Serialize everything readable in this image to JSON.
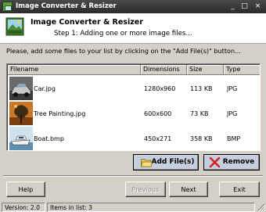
{
  "window": {
    "title": "Image Converter & Resizer",
    "controls": {
      "minimize": "_",
      "maximize": "□",
      "close": "×"
    }
  },
  "header": {
    "title": "Image Converter & Resizer",
    "step": "Step 1: Adding one or more image files..."
  },
  "instruction": "Please, add some files to your list by clicking on the \"Add File(s)\" button...",
  "file_list": {
    "columns": [
      "Filename",
      "Dimensions",
      "Size",
      "Type"
    ],
    "rows": [
      {
        "filename": "Car.jpg",
        "dimensions": "1280x960",
        "size": "113 KB",
        "type": "JPG",
        "thumb": "car"
      },
      {
        "filename": "Tree Painting.jpg",
        "dimensions": "600x600",
        "size": "73 KB",
        "type": "JPG",
        "thumb": "tree-painting"
      },
      {
        "filename": "Boat.bmp",
        "dimensions": "450x271",
        "size": "358 KB",
        "type": "BMP",
        "thumb": "boat"
      }
    ]
  },
  "actions": {
    "add_files": "Add File(s)",
    "remove": "Remove"
  },
  "nav": {
    "help": "Help",
    "previous": "Previous",
    "next": "Next",
    "exit": "Exit"
  },
  "status": {
    "version": "Version: 2.0",
    "items": "Items in list: 3"
  },
  "colors": {
    "titlebar": "#2b2b2b",
    "button_face": "#d4d0c8",
    "action_button": "#c6cfe0",
    "remove_icon": "#d42020"
  }
}
